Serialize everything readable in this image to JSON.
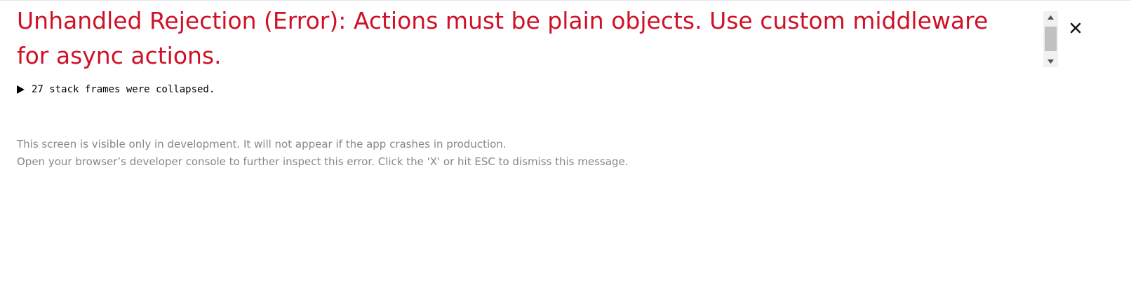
{
  "error": {
    "title": "Unhandled Rejection (Error): Actions must be plain objects. Use custom middleware for async actions."
  },
  "stack": {
    "collapsed_label": "27 stack frames were collapsed."
  },
  "footer": {
    "line1": "This screen is visible only in development. It will not appear if the app crashes in production.",
    "line2": "Open your browser’s developer console to further inspect this error.  Click the 'X' or hit ESC to dismiss this message."
  },
  "icons": {
    "close": "close-icon",
    "stack_toggle": "triangle-right-icon",
    "scroll_up": "scroll-up-arrow-icon",
    "scroll_down": "scroll-down-arrow-icon"
  },
  "colors": {
    "error_title": "#ce1126",
    "footer_text": "#878787",
    "stack_text": "#000000"
  }
}
